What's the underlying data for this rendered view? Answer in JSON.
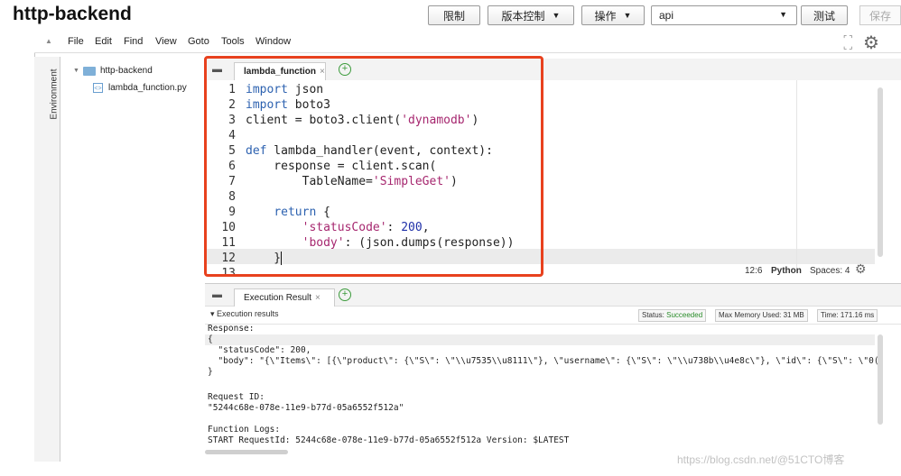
{
  "header": {
    "function_name": "http-backend",
    "buttons": {
      "throttle": "限制",
      "versions": "版本控制",
      "actions": "操作",
      "test": "测试",
      "save": "保存"
    },
    "qualifier": "api"
  },
  "menu": [
    "File",
    "Edit",
    "Find",
    "View",
    "Goto",
    "Tools",
    "Window"
  ],
  "environment_label": "Environment",
  "tree": {
    "folder": "http-backend",
    "file": "lambda_function.py"
  },
  "editor": {
    "tab_label": "lambda_function",
    "line_numbers": [
      "1",
      "2",
      "3",
      "4",
      "5",
      "6",
      "7",
      "8",
      "9",
      "10",
      "11",
      "12",
      "13"
    ],
    "lines": [
      {
        "k1": "import",
        "t1": " json"
      },
      {
        "k1": "import",
        "t1": " boto3"
      },
      {
        "t1": "client = boto3.client(",
        "s1": "'dynamodb'",
        "t2": ")"
      },
      {},
      {
        "k1": "def",
        "t1": " lambda_handler(event, context):"
      },
      {
        "t1": "    response = client.scan("
      },
      {
        "t1": "        TableName=",
        "s1": "'SimpleGet'",
        "t2": ")"
      },
      {},
      {
        "t0": "    ",
        "k1": "return",
        "t1": " {"
      },
      {
        "t0": "        ",
        "s1": "'statusCode'",
        "t1": ": ",
        "n1": "200",
        "t2": ","
      },
      {
        "t0": "        ",
        "s1": "'body'",
        "t1": ": (json.dumps(response))"
      },
      {
        "t1": "    }"
      },
      {}
    ],
    "status": {
      "cursor": "12:6",
      "language": "Python",
      "spaces": "Spaces: 4"
    }
  },
  "results": {
    "tab_label": "Execution Result",
    "section_title": "▾ Execution results",
    "status_label": "Status: ",
    "status_value": "Succeeded",
    "max_memory": "Max Memory Used: 31 MB",
    "time": "Time: 171.16 ms",
    "lines": [
      "Response:",
      "{",
      "  \"statusCode\": 200,",
      "  \"body\": \"{\\\"Items\\\": [{\\\"product\\\": {\\\"S\\\": \\\"\\\\u7535\\\\u8111\\\"}, \\\"username\\\": {\\\"S\\\": \\\"\\\\u738b\\\\u4e8c\\\"}, \\\"id\\\": {\\\"S\\\": \\\"0(",
      "}",
      "",
      "Request ID:",
      "\"5244c68e-078e-11e9-b77d-05a6552f512a\"",
      "",
      "Function Logs:",
      "START RequestId: 5244c68e-078e-11e9-b77d-05a6552f512a Version: $LATEST"
    ]
  },
  "watermark": "https://blog.csdn.net/@51CTO博客"
}
